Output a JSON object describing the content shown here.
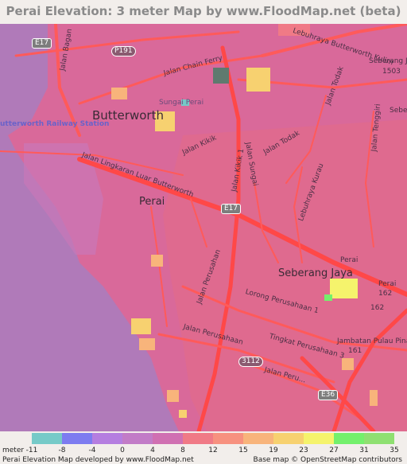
{
  "header": {
    "title": "Perai Elevation: 3 meter Map by www.FloodMap.net (beta)"
  },
  "map": {
    "labels": {
      "butterworth": "Butterworth",
      "perai": "Perai",
      "seberang_jaya": "Seberang Jaya",
      "sungai_perai": "Sungai Perai",
      "railway_station": "utterworth Railway Station",
      "jalan_bagan": "Jalan Bagan",
      "jalan_chain_ferry": "Jalan Chain Ferry",
      "lebuhraya_butterworth_kulim": "Lebuhraya Butterworth Kulim",
      "seberang_top": "Seberang Jaya",
      "code_1503": "1503",
      "jalan_todak": "Jalan Todak",
      "jalan_todak_2": "Jalan Todak",
      "jalan_tenggiri": "Jalan Tenggiri",
      "jalan_kikik": "Jalan Kikik",
      "jalan_kikik_1": "Jalan Kikik 1",
      "lingkaran": "Jalan Lingkaran Luar Butterworth",
      "lebuhraya_kurau": "Lebuhraya Kurau",
      "jalan_perusahan": "Jalan Perusahan",
      "lorong_perusahaan_1": "Lorong Perusahaan 1",
      "jalan_perusahaan": "Jalan Perusahaan",
      "tingkat_perusahaan_3": "Tingkat Perusahaan 3",
      "jalan_perusahaan_b": "Jalan Peru...",
      "jambatan": "Jambatan Pulau Pinang",
      "perai_right": "Perai",
      "perai_right2": "Perai",
      "code_162": "162",
      "code_162b": "162",
      "code_161": "161",
      "sebera_right": "Sebera",
      "jalan_sungai": "Jalan Sungai"
    },
    "shields": {
      "e17_top": "E17",
      "p191": "P191",
      "e17_mid": "E17",
      "r3112": "3112",
      "e36": "E36"
    },
    "colors": {
      "sea": "#b07ab9",
      "land_low": "#dc6f8e",
      "road": "#ff6262",
      "major_road": "#ff4848"
    }
  },
  "legend": {
    "unit": "meter",
    "ticks": [
      "-11",
      "-8",
      "-4",
      "0",
      "4",
      "8",
      "12",
      "15",
      "19",
      "23",
      "27",
      "31",
      "35"
    ],
    "colors": [
      "#76cac8",
      "#7d7cf0",
      "#b57ee0",
      "#c27cc7",
      "#d070b2",
      "#f07a86",
      "#f7917f",
      "#f8b47b",
      "#f7d170",
      "#f5f36c",
      "#74f06c",
      "#8fe071"
    ],
    "credit_left": "Perai Elevation Map developed by www.FloodMap.net",
    "credit_right": "Base map © OpenStreetMap contributors"
  }
}
